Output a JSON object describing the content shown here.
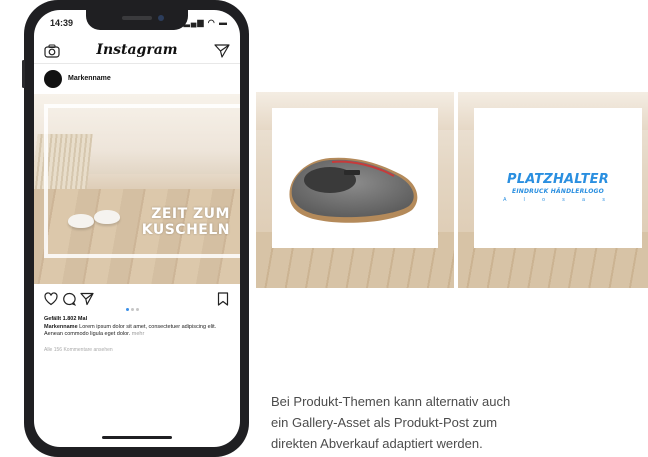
{
  "status": {
    "time": "14:39",
    "icons": "▂▄▆ ◠ ▬"
  },
  "instagram": {
    "logo": "Instagram",
    "brand_name": "Markenname",
    "headline_line1": "ZEIT ZUM",
    "headline_line2": "KUSCHELN",
    "likes": "Gefällt 1.802 Mal",
    "caption_user": "Markenname",
    "caption_text": "Lorem ipsum dolor sit amet, consectetuer adipiscing elit. Aenean commodo ligula eget dolor.",
    "caption_more": "mehr",
    "comments": "Alle 156 Kommentare ansehen"
  },
  "gallery": {
    "placeholder_title": "PLATZHALTER",
    "placeholder_sub": "EINDRUCK HÄNDLERLOGO",
    "placeholder_letters": "A l o s a s"
  },
  "description": {
    "line1": "Bei Produkt-Themen kann alternativ auch",
    "line2": "ein Gallery-Asset als Produkt-Post zum",
    "line3": "direkten Abverkauf adaptiert werden."
  },
  "colors": {
    "accent_blue": "#2a8fe0",
    "phone_body": "#1f1f22"
  }
}
